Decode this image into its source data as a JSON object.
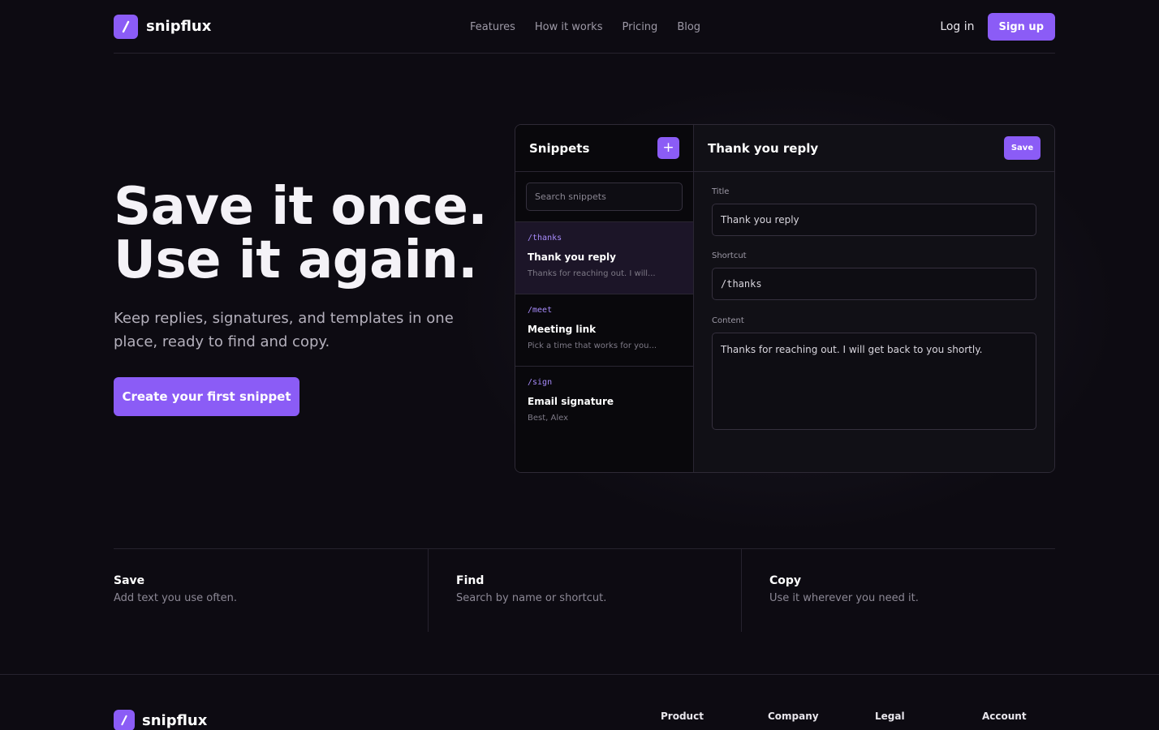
{
  "brand": {
    "name": "snipflux"
  },
  "nav": {
    "links": [
      "Features",
      "How it works",
      "Pricing",
      "Blog"
    ],
    "login": "Log in",
    "signup": "Sign up"
  },
  "hero": {
    "title_line1": "Save it once.",
    "title_line2": "Use it again.",
    "subtitle": "Keep replies, signatures, and templates in one place, ready to find and copy.",
    "cta": "Create your first snippet"
  },
  "app": {
    "sidebar": {
      "title": "Snippets",
      "add_label": "+",
      "search_placeholder": "Search snippets",
      "items": [
        {
          "shortcut": "/thanks",
          "title": "Thank you reply",
          "preview": "Thanks for reaching out. I will...",
          "active": true
        },
        {
          "shortcut": "/meet",
          "title": "Meeting link",
          "preview": "Pick a time that works for you...",
          "active": false
        },
        {
          "shortcut": "/sign",
          "title": "Email signature",
          "preview": "Best, Alex",
          "active": false
        }
      ]
    },
    "editor": {
      "header_title": "Thank you reply",
      "save_label": "Save",
      "title_label": "Title",
      "title_value": "Thank you reply",
      "shortcut_label": "Shortcut",
      "shortcut_value": "/thanks",
      "content_label": "Content",
      "content_value": "Thanks for reaching out. I will get back to you shortly."
    }
  },
  "features": [
    {
      "title": "Save",
      "desc": "Add text you use often."
    },
    {
      "title": "Find",
      "desc": "Search by name or shortcut."
    },
    {
      "title": "Copy",
      "desc": "Use it wherever you need it."
    }
  ],
  "footer": {
    "brand": "snipflux",
    "columns": [
      "Product",
      "Company",
      "Legal",
      "Account"
    ]
  },
  "colors": {
    "accent": "#8b5cf6",
    "accent_text": "#a78bfa",
    "background": "#0d0b12"
  }
}
